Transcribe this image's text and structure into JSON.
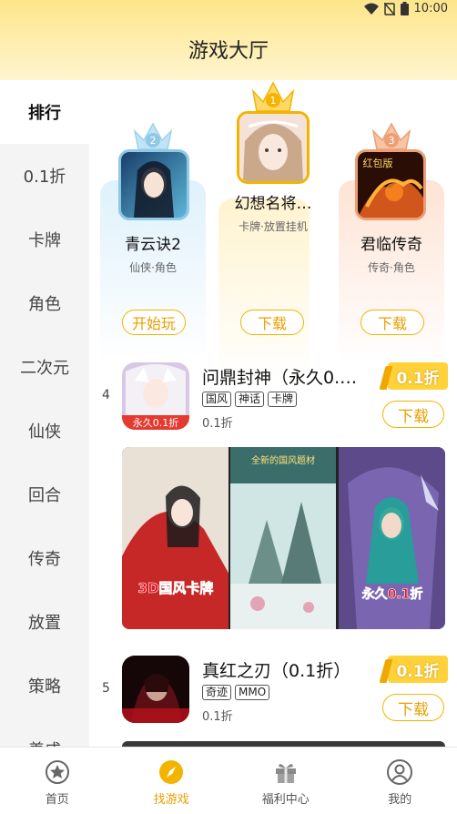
{
  "status_bar": {
    "time": "10:00",
    "icons": [
      "wifi-icon",
      "no-sim-icon",
      "battery-icon"
    ]
  },
  "header": {
    "title": "游戏大厅"
  },
  "sidebar": {
    "items": [
      {
        "label": "排行",
        "active": true
      },
      {
        "label": "0.1折"
      },
      {
        "label": "卡牌"
      },
      {
        "label": "角色"
      },
      {
        "label": "二次元"
      },
      {
        "label": "仙侠"
      },
      {
        "label": "回合"
      },
      {
        "label": "传奇"
      },
      {
        "label": "放置"
      },
      {
        "label": "策略"
      },
      {
        "label": "养成"
      }
    ]
  },
  "podium": {
    "first": {
      "rank": "1",
      "name": "幻想名将…",
      "tags": "卡牌·放置挂机",
      "button": "下载"
    },
    "second": {
      "rank": "2",
      "name": "青云诀2",
      "tags": "仙侠·角色",
      "button": "开始玩"
    },
    "third": {
      "rank": "3",
      "name": "君临传奇",
      "tags": "传奇·角色",
      "button": "下载",
      "thumb_text": "红包版"
    }
  },
  "list": [
    {
      "rank": "4",
      "title": "问鼎封神（永久0.…",
      "tags": [
        "国风",
        "神话",
        "卡牌"
      ],
      "discount_text": "0.1折",
      "badge": "0.1折",
      "button": "下载",
      "icon_text": "永久0.1折",
      "gallery": {
        "shot1_text": "3D国风卡牌",
        "shot2_text": "全新的国风题材",
        "shot3_text": "永久0.1折"
      }
    },
    {
      "rank": "5",
      "title": "真红之刃（0.1折）",
      "tags": [
        "奇迹",
        "MMO"
      ],
      "discount_text": "0.1折",
      "badge": "0.1折",
      "button": "下载"
    }
  ],
  "tabbar": {
    "tabs": [
      {
        "label": "首页",
        "icon": "star-circle-icon"
      },
      {
        "label": "找游戏",
        "icon": "compass-icon",
        "active": true
      },
      {
        "label": "福利中心",
        "icon": "gift-icon"
      },
      {
        "label": "我的",
        "icon": "user-icon"
      }
    ]
  },
  "colors": {
    "accent": "#f3b400",
    "header": "#fde58a",
    "badge": "#ffd23a"
  }
}
